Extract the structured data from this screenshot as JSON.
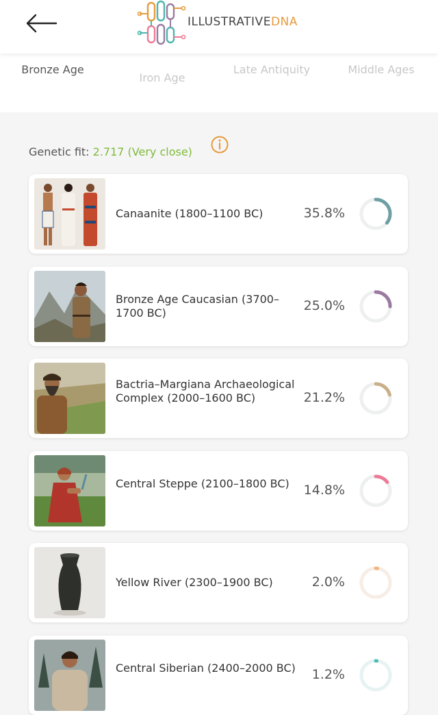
{
  "header": {
    "logo_text_main": "ILLUSTRATIVE",
    "logo_text_accent": "DNA"
  },
  "tabs": [
    {
      "label": "Bronze Age",
      "active": true
    },
    {
      "label": "Iron Age",
      "active": false
    },
    {
      "label": "Late Antiquity",
      "active": false
    },
    {
      "label": "Middle Ages",
      "active": false
    }
  ],
  "fit": {
    "label": "Genetic fit: ",
    "value": "2.717 (Very close)"
  },
  "populations": [
    {
      "name": "Canaanite (1800–1100 BC)",
      "percent": "35.8%",
      "fraction": 0.358,
      "color": "#6f9fa5",
      "icon": "group-of-three-figures-image"
    },
    {
      "name": "Bronze Age Caucasian (3700–1700 BC)",
      "percent": "25.0%",
      "fraction": 0.25,
      "color": "#9a7aa0",
      "icon": "man-in-mountains-image"
    },
    {
      "name": "Bactria–Margiana Archaeological Complex (2000–1600 BC)",
      "percent": "21.2%",
      "fraction": 0.212,
      "color": "#c9b08a",
      "icon": "bearded-man-valley-image"
    },
    {
      "name": "Central Steppe (2100–1800 BC)",
      "percent": "14.8%",
      "fraction": 0.148,
      "color": "#ef7a95",
      "icon": "seated-woman-steppe-image"
    },
    {
      "name": "Yellow River (2300–1900 BC)",
      "percent": "2.0%",
      "fraction": 0.02,
      "color": "#f3b57e",
      "icon": "black-vase-image"
    },
    {
      "name": "Central Siberian (2400–2000 BC)",
      "percent": "1.2%",
      "fraction": 0.012,
      "color": "#4fbcb4",
      "icon": "man-in-fur-forest-image"
    }
  ]
}
